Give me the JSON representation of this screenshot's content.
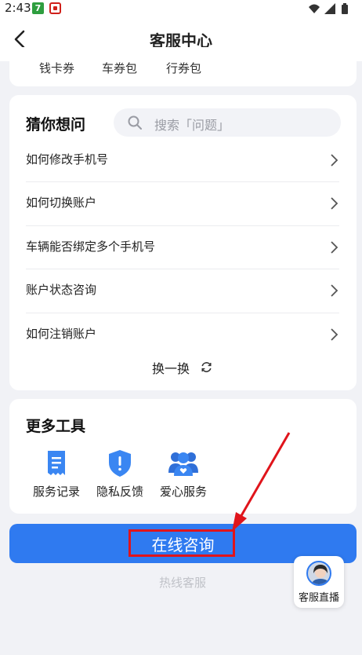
{
  "status_bar": {
    "time": "2:43"
  },
  "nav": {
    "title": "客服中心"
  },
  "wallet": {
    "items": [
      "钱卡券",
      "车券包",
      "行券包"
    ]
  },
  "guess": {
    "title": "猜你想问",
    "search_placeholder": "搜索「问题」",
    "questions": [
      "如何修改手机号",
      "如何切换账户",
      "车辆能否绑定多个手机号",
      "账户状态咨询",
      "如何注销账户"
    ],
    "refresh_label": "换一换"
  },
  "tools": {
    "title": "更多工具",
    "items": [
      {
        "label": "服务记录",
        "icon": "receipt-icon"
      },
      {
        "label": "隐私反馈",
        "icon": "shield-icon"
      },
      {
        "label": "爱心服务",
        "icon": "people-heart-icon"
      }
    ]
  },
  "consult_button": {
    "label": "在线咨询"
  },
  "hotline": {
    "label": "热线客服"
  },
  "live_float": {
    "label": "客服直播"
  },
  "colors": {
    "accent": "#2f7af0",
    "highlight": "#e0141b"
  }
}
